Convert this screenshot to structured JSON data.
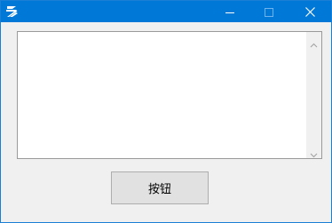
{
  "window": {
    "title_bar_color": "#0078d7",
    "app_icon": "app-logo-icon",
    "controls": {
      "minimize_icon": "minimize-icon",
      "maximize_icon": "maximize-icon",
      "close_icon": "close-icon"
    }
  },
  "textbox": {
    "value": "",
    "scroll_up_icon": "scroll-up-icon",
    "scroll_down_icon": "scroll-down-icon"
  },
  "button": {
    "label": "按钮"
  }
}
